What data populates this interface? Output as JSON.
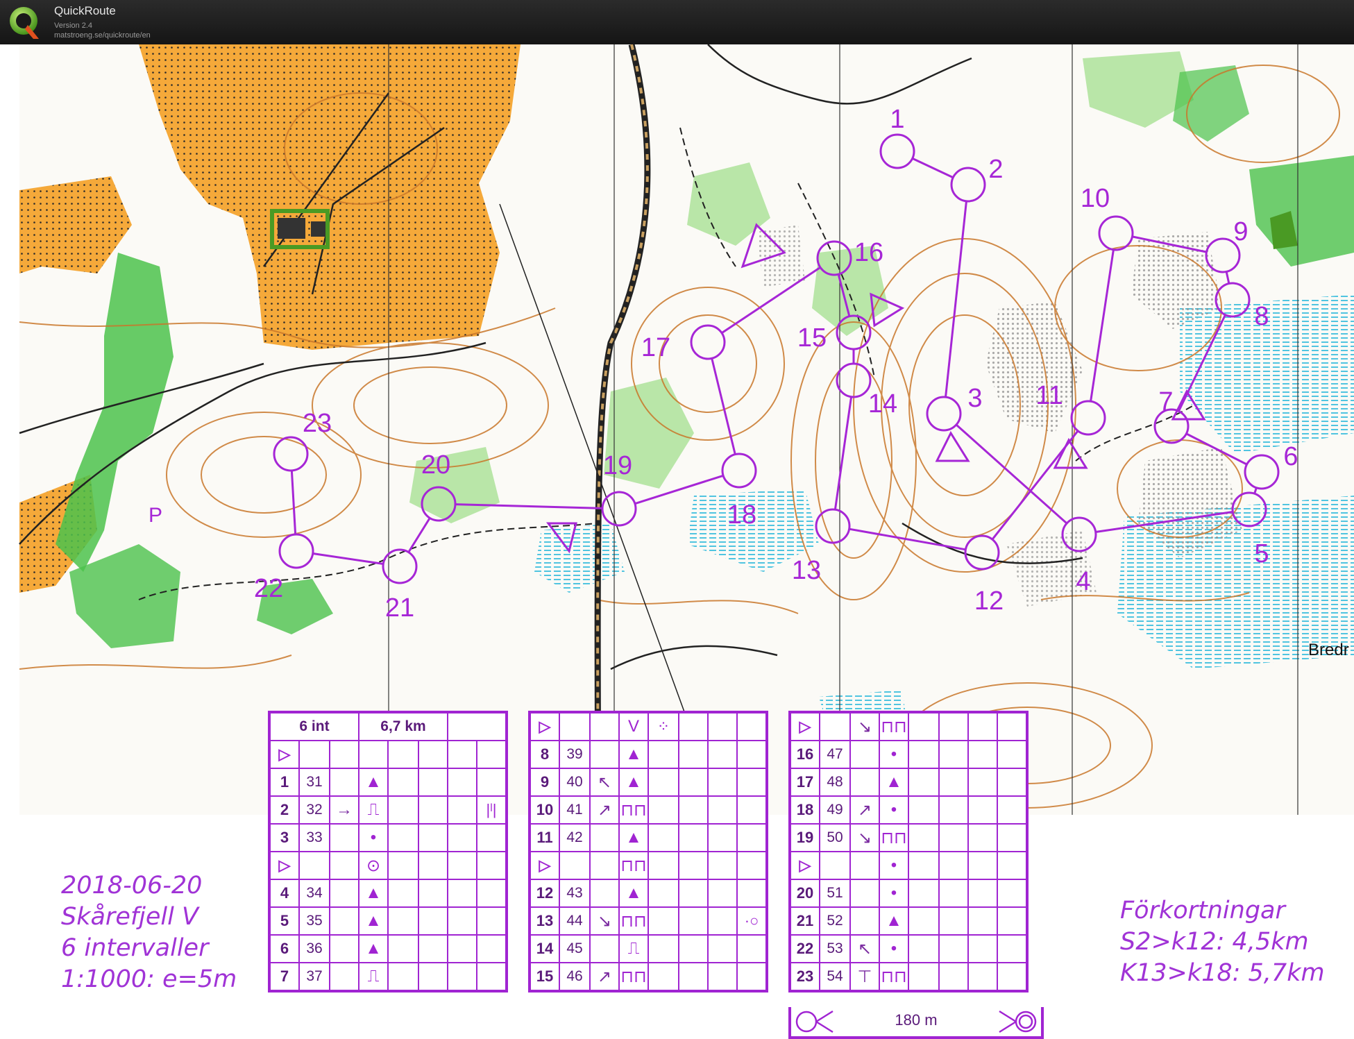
{
  "app": {
    "title": "QuickRoute",
    "version": "Version 2.4",
    "url": "matstroeng.se/quickroute/en"
  },
  "map": {
    "place_labels": [
      "Bredr",
      "P"
    ],
    "colors": {
      "course": "#a626d6",
      "forest_green": "#4cc24c",
      "light_green": "#b9e6a8",
      "open_land": "#f7a934",
      "contour": "#c9772a",
      "water": "#4fc4e0",
      "rock": "#9a9a9a"
    }
  },
  "course": {
    "controls": [
      {
        "num": "1"
      },
      {
        "num": "2"
      },
      {
        "num": "3"
      },
      {
        "num": "4"
      },
      {
        "num": "5"
      },
      {
        "num": "6"
      },
      {
        "num": "7"
      },
      {
        "num": "8"
      },
      {
        "num": "9"
      },
      {
        "num": "10"
      },
      {
        "num": "11"
      },
      {
        "num": "12"
      },
      {
        "num": "13"
      },
      {
        "num": "14"
      },
      {
        "num": "15"
      },
      {
        "num": "16"
      },
      {
        "num": "17"
      },
      {
        "num": "18"
      },
      {
        "num": "19"
      },
      {
        "num": "20"
      },
      {
        "num": "21"
      },
      {
        "num": "22"
      },
      {
        "num": "23"
      }
    ]
  },
  "info_left": {
    "date": "2018-06-20",
    "area": "Skårefjell V",
    "intervals": "6 intervaller",
    "scale": "1:1000: e=5m"
  },
  "info_right": {
    "title": "Förkortningar",
    "short1": "S2>k12: 4,5km",
    "short2": "K13>k18: 5,7km"
  },
  "description": {
    "header": {
      "intervals": "6 int",
      "length": "6,7 km"
    },
    "columns": [
      [
        [
          "▷",
          "",
          "",
          "",
          "",
          "",
          "",
          ""
        ],
        [
          "1",
          "31",
          "",
          "▲",
          "",
          "",
          "",
          ""
        ],
        [
          "2",
          "32",
          "→",
          "⎍",
          "",
          "",
          "",
          "|ˡ|"
        ],
        [
          "3",
          "33",
          "",
          "•",
          "",
          "",
          "",
          ""
        ],
        [
          "▷",
          "",
          "",
          "⊙",
          "",
          "",
          "",
          ""
        ],
        [
          "4",
          "34",
          "",
          "▲",
          "",
          "",
          "",
          ""
        ],
        [
          "5",
          "35",
          "",
          "▲",
          "",
          "",
          "",
          ""
        ],
        [
          "6",
          "36",
          "",
          "▲",
          "",
          "",
          "",
          ""
        ],
        [
          "7",
          "37",
          "",
          "⎍",
          "",
          "",
          "",
          ""
        ]
      ],
      [
        [
          "▷",
          "",
          "",
          "V",
          "⁘",
          "",
          "",
          ""
        ],
        [
          "8",
          "39",
          "",
          "▲",
          "",
          "",
          "",
          ""
        ],
        [
          "9",
          "40",
          "↖",
          "▲",
          "",
          "",
          "",
          ""
        ],
        [
          "10",
          "41",
          "↗",
          "⊓⊓",
          "",
          "",
          "",
          ""
        ],
        [
          "11",
          "42",
          "",
          "▲",
          "",
          "",
          "",
          ""
        ],
        [
          "▷",
          "",
          "",
          "⊓⊓",
          "",
          "",
          "",
          ""
        ],
        [
          "12",
          "43",
          "",
          "▲",
          "",
          "",
          "",
          ""
        ],
        [
          "13",
          "44",
          "↘",
          "⊓⊓",
          "",
          "",
          "",
          "·○"
        ],
        [
          "14",
          "45",
          "",
          "⎍",
          "",
          "",
          "",
          ""
        ],
        [
          "15",
          "46",
          "↗",
          "⊓⊓",
          "",
          "",
          "",
          ""
        ]
      ],
      [
        [
          "▷",
          "",
          "↘",
          "⊓⊓",
          "",
          "",
          "",
          ""
        ],
        [
          "16",
          "47",
          "",
          "•",
          "",
          "",
          "",
          ""
        ],
        [
          "17",
          "48",
          "",
          "▲",
          "",
          "",
          "",
          ""
        ],
        [
          "18",
          "49",
          "↗",
          "•",
          "",
          "",
          "",
          ""
        ],
        [
          "19",
          "50",
          "↘",
          "⊓⊓",
          "",
          "",
          "",
          ""
        ],
        [
          "▷",
          "",
          "",
          "•",
          "",
          "",
          "",
          ""
        ],
        [
          "20",
          "51",
          "",
          "•",
          "",
          "",
          "",
          ""
        ],
        [
          "21",
          "52",
          "",
          "▲",
          "",
          "",
          "",
          ""
        ],
        [
          "22",
          "53",
          "↖",
          "•",
          "",
          "",
          "",
          ""
        ],
        [
          "23",
          "54",
          "⊤",
          "⊓⊓",
          "",
          "",
          "",
          ""
        ]
      ]
    ],
    "footer": {
      "distance": "180 m"
    }
  }
}
